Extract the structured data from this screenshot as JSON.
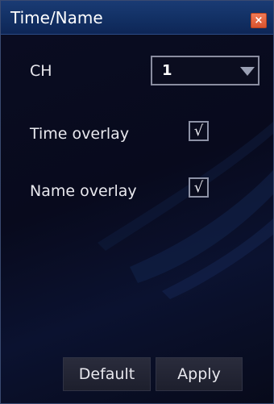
{
  "dialog": {
    "title": "Time/Name",
    "close_glyph": "×",
    "close_icon": "close-icon",
    "channel": {
      "label": "CH",
      "value": "1",
      "dropdown_icon": "chevron-down-icon"
    },
    "time_overlay": {
      "label": "Time overlay",
      "checked": true,
      "check_glyph": "√"
    },
    "name_overlay": {
      "label": "Name overlay",
      "checked": true,
      "check_glyph": "√"
    },
    "buttons": {
      "default_label": "Default",
      "apply_label": "Apply"
    },
    "colors": {
      "titlebar": "#123064",
      "background": "#080a1d",
      "close": "#d9532f",
      "text": "#e8e8ee"
    }
  }
}
